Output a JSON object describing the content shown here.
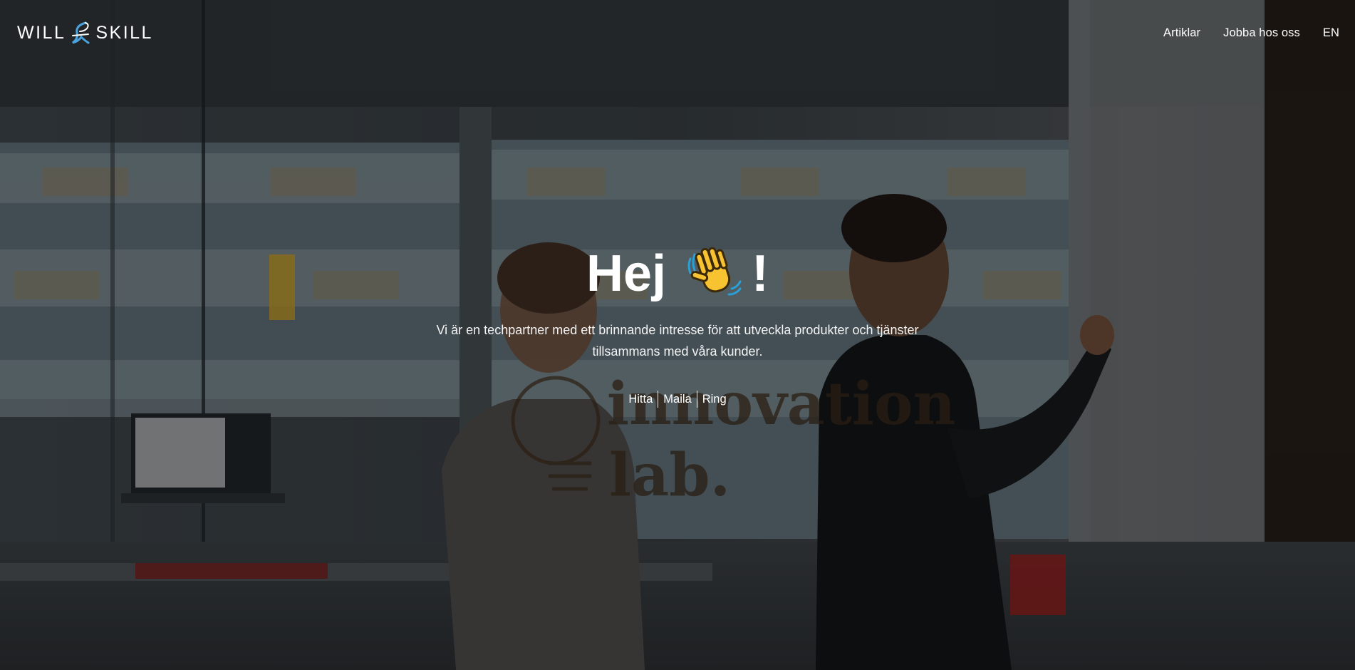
{
  "header": {
    "logo": {
      "left": "WILL",
      "right": "SKILL"
    },
    "nav": [
      {
        "label": "Artiklar"
      },
      {
        "label": "Jobba hos oss"
      },
      {
        "label": "EN"
      }
    ]
  },
  "hero": {
    "heading_start": "Hej",
    "heading_icon": "waving-hand-icon",
    "heading_end": "!",
    "intro": "Vi är en techpartner med ett brinnande intresse för att utveckla produkter och tjänster tillsammans med våra kunder.",
    "contact_links": [
      {
        "label": "Hitta"
      },
      {
        "label": "Maila"
      },
      {
        "label": "Ring"
      }
    ],
    "background_text": {
      "line1": "innovation",
      "line2": "lab."
    }
  },
  "colors": {
    "text": "#ffffff",
    "logo_accent": "#4aa3df",
    "wave_hand": "#f7c331"
  }
}
